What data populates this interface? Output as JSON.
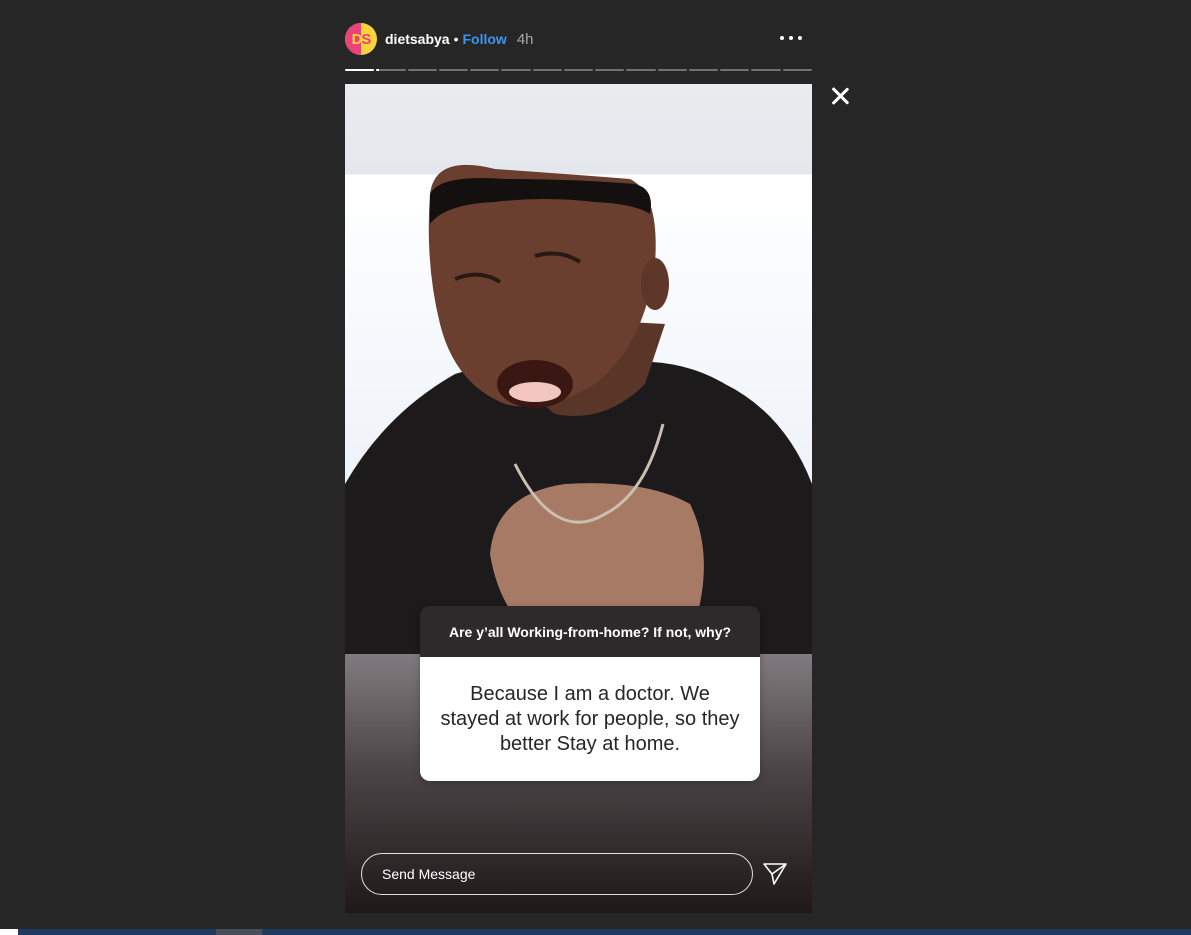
{
  "header": {
    "avatar_letters": [
      "D",
      "S"
    ],
    "username": "dietsabya",
    "separator": "•",
    "follow_label": "Follow",
    "time": "4h"
  },
  "progress": {
    "segments": 15,
    "current_index": 0,
    "current_fraction": 1.0,
    "next_fraction": 0.1
  },
  "sticker": {
    "question": "Are y’all Working-from-home? If not, why?",
    "answer": "Because I am a doctor. We stayed at work for people, so they better Stay at home."
  },
  "reply": {
    "placeholder": "Send Message"
  },
  "icons": {
    "more": "more-options-icon",
    "close": "close-icon",
    "send": "send-icon"
  },
  "colors": {
    "background": "#262626",
    "follow": "#3897f0",
    "avatar_pink": "#e9437a",
    "avatar_yellow": "#f7d43a"
  }
}
